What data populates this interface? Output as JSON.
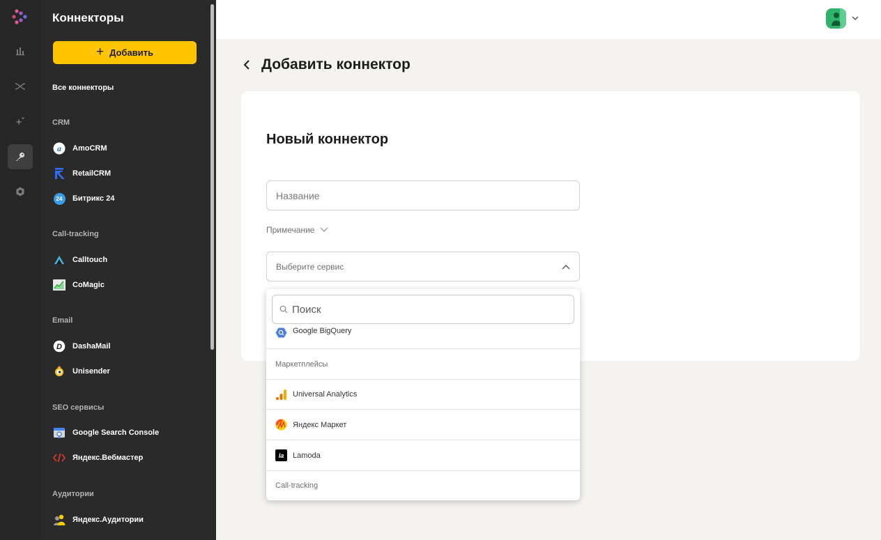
{
  "sidebar": {
    "title": "Коннекторы",
    "add_label": "Добавить",
    "all_connectors": "Все коннекторы",
    "sections": [
      {
        "title": "CRM",
        "items": [
          "AmoCRM",
          "RetailCRM",
          "Битрикс 24"
        ]
      },
      {
        "title": "Call-tracking",
        "items": [
          "Calltouch",
          "CoMagic"
        ]
      },
      {
        "title": "Email",
        "items": [
          "DashaMail",
          "Unisender"
        ]
      },
      {
        "title": "SEO сервисы",
        "items": [
          "Google Search Console",
          "Яндекс.Вебмастер"
        ]
      },
      {
        "title": "Аудитории",
        "items": [
          "Яндекс.Аудитории"
        ]
      }
    ],
    "bitrix_badge": "24",
    "add_button_color": "#ffc500"
  },
  "rail": {
    "icons": [
      "logo-icon",
      "chart-icon",
      "shuffle-icon",
      "sparkle-icon",
      "key-icon",
      "gear-icon"
    ],
    "active": "key-icon"
  },
  "page": {
    "title": "Добавить коннектор",
    "form_title": "Новый коннектор",
    "name_placeholder": "Название",
    "note_label": "Примечание",
    "service_placeholder": "Выберите сервис"
  },
  "dropdown": {
    "search_placeholder": "Поиск",
    "rows": [
      "Google BigQuery",
      "Маркетплейсы",
      "Universal Analytics",
      "Яндекс Маркет",
      "Lamoda",
      "Call-tracking"
    ],
    "lamoda_glyph": "la"
  }
}
